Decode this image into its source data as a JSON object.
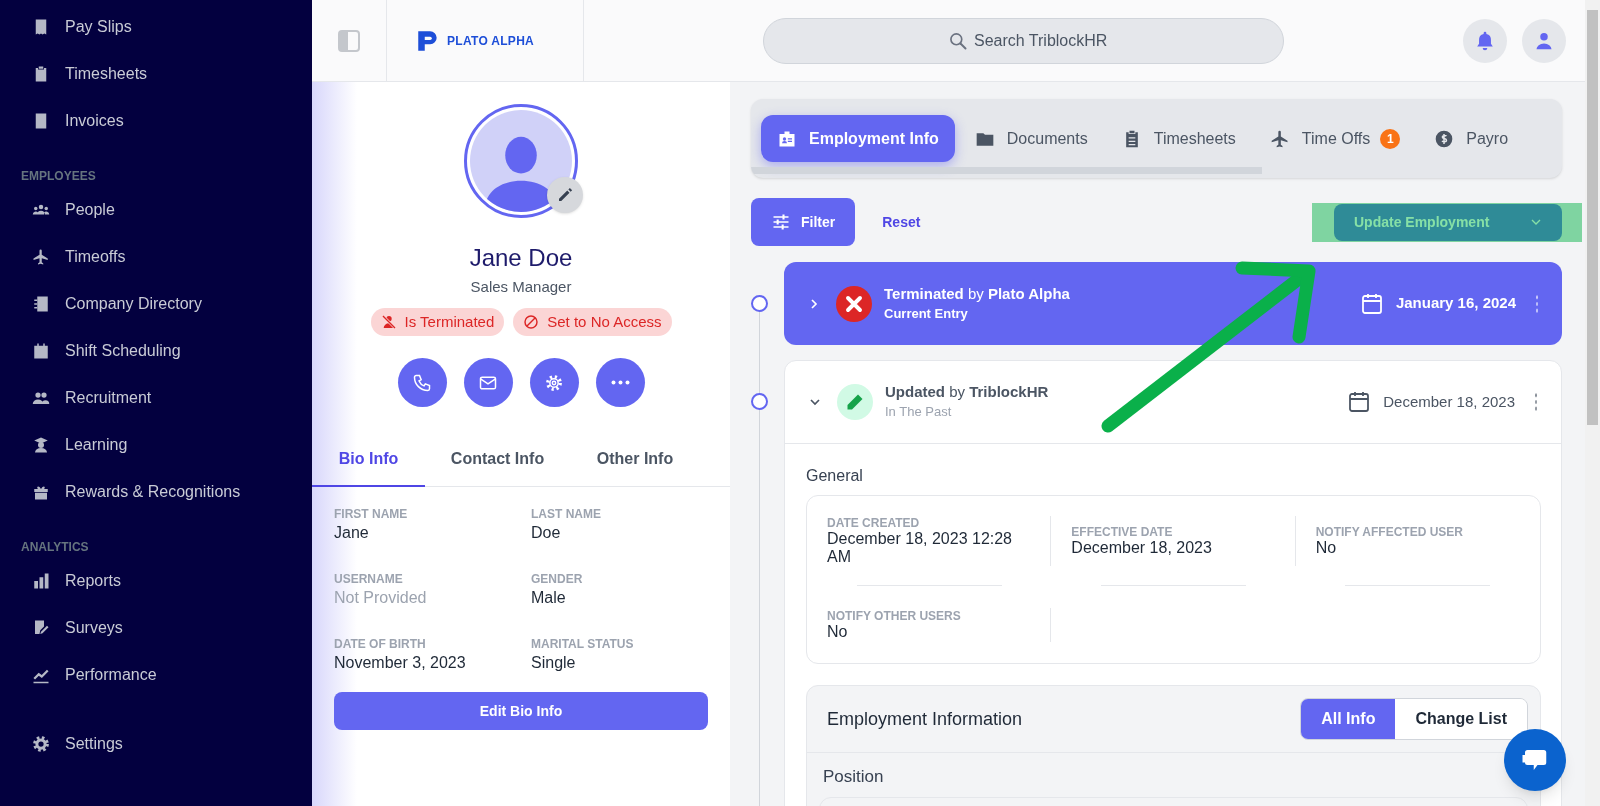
{
  "sidebar": {
    "sections": [
      {
        "items": [
          {
            "label": "Pay Slips"
          },
          {
            "label": "Timesheets"
          },
          {
            "label": "Invoices"
          }
        ]
      },
      {
        "heading": "EMPLOYEES",
        "items": [
          {
            "label": "People"
          },
          {
            "label": "Timeoffs"
          },
          {
            "label": "Company Directory"
          },
          {
            "label": "Shift Scheduling"
          },
          {
            "label": "Recruitment"
          },
          {
            "label": "Learning"
          },
          {
            "label": "Rewards & Recognitions"
          }
        ]
      },
      {
        "heading": "ANALYTICS",
        "items": [
          {
            "label": "Reports"
          },
          {
            "label": "Surveys"
          },
          {
            "label": "Performance"
          }
        ]
      },
      {
        "items": [
          {
            "label": "Settings"
          }
        ]
      }
    ]
  },
  "topbar": {
    "logo": "PLATO ALPHA",
    "search": {
      "placeholder": "Search TriblockHR"
    }
  },
  "profile": {
    "name": "Jane Doe",
    "title": "Sales Manager",
    "badges": [
      {
        "label": "Is Terminated"
      },
      {
        "label": "Set to No Access"
      }
    ],
    "tabs": [
      {
        "label": "Bio Info",
        "selected": true
      },
      {
        "label": "Contact Info",
        "selected": false
      },
      {
        "label": "Other Info",
        "selected": false
      }
    ],
    "fields": [
      {
        "label": "FIRST NAME",
        "value": "Jane",
        "muted": false
      },
      {
        "label": "LAST NAME",
        "value": "Doe",
        "muted": false
      },
      {
        "label": "USERNAME",
        "value": "Not Provided",
        "muted": true
      },
      {
        "label": "GENDER",
        "value": "Male",
        "muted": false
      },
      {
        "label": "DATE OF BIRTH",
        "value": "November 3, 2023",
        "muted": false
      },
      {
        "label": "MARITAL STATUS",
        "value": "Single",
        "muted": false
      }
    ],
    "edit_button": "Edit Bio Info"
  },
  "content": {
    "tabs": [
      {
        "label": "Employment Info",
        "selected": true
      },
      {
        "label": "Documents",
        "selected": false
      },
      {
        "label": "Timesheets",
        "selected": false
      },
      {
        "label": "Time Offs",
        "selected": false,
        "badge": "1"
      },
      {
        "label": "Payro",
        "selected": false
      }
    ],
    "filter_button": "Filter",
    "reset_link": "Reset",
    "update_button": {
      "label": "Update Employment",
      "highlighted": true
    },
    "timeline": [
      {
        "kind": "terminated",
        "title": "**Terminated** by **Plato Alpha**",
        "subtitle": "Current Entry",
        "date": "January 16, 2024",
        "current": true,
        "expanded": false
      },
      {
        "kind": "updated",
        "title": "**Updated** by **TriblockHR**",
        "subtitle": "In The Past",
        "date": "December 18, 2023",
        "current": false,
        "expanded": true,
        "general": {
          "heading": "General",
          "fields": [
            {
              "label": "DATE CREATED",
              "value": "December 18, 2023 12:28 AM"
            },
            {
              "label": "EFFECTIVE DATE",
              "value": "December 18, 2023"
            },
            {
              "label": "NOTIFY AFFECTED USER",
              "value": "No"
            },
            {
              "label": "NOTIFY OTHER USERS",
              "value": "No"
            }
          ]
        },
        "employment_information": {
          "heading": "Employment Information",
          "toggle": [
            {
              "label": "All Info",
              "selected": true
            },
            {
              "label": "Change List",
              "selected": false
            }
          ],
          "position_heading": "Position"
        }
      }
    ]
  }
}
